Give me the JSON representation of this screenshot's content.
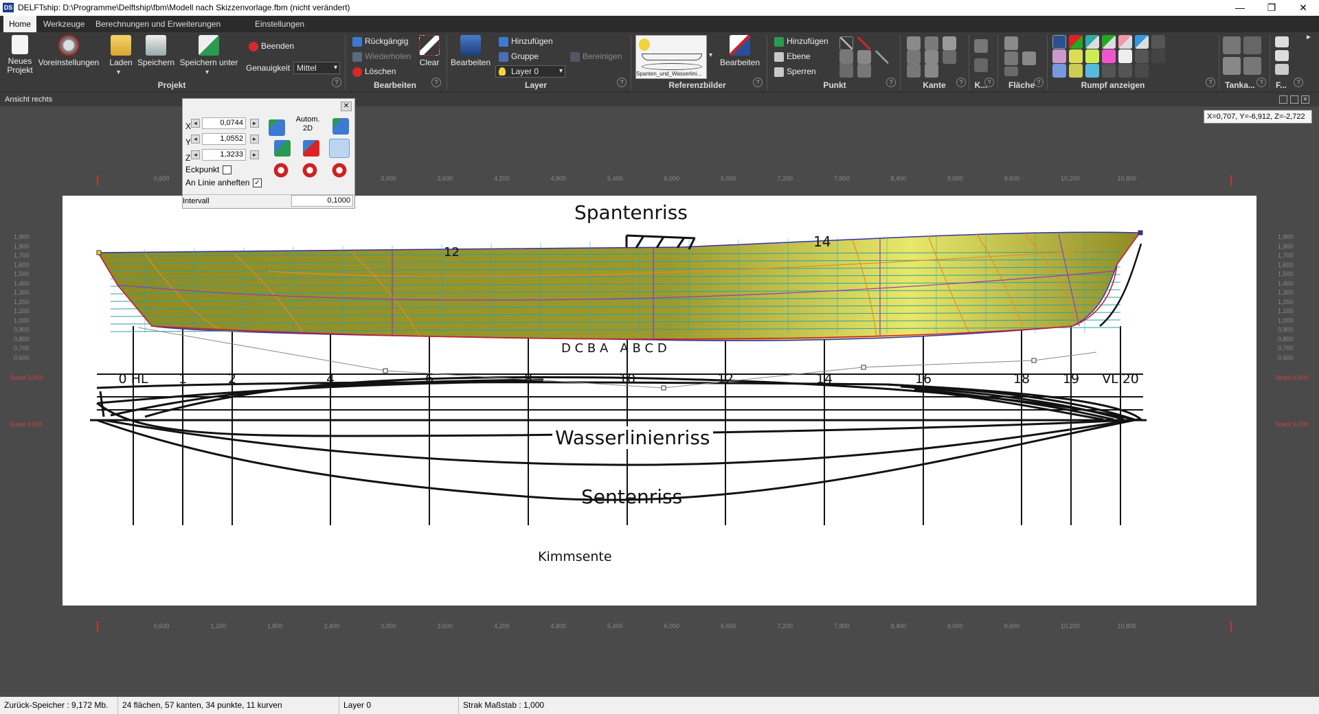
{
  "window": {
    "app_icon": "DS",
    "title": "DELFTship: D:\\Programme\\Delftship\\fbm\\Modell nach Skizzenvorlage.fbm (nicht verändert)",
    "minimize": "—",
    "maximize": "❐",
    "close": "✕"
  },
  "menu": {
    "tabs": [
      "Home",
      "Werkzeuge",
      "Berechnungen und Erweiterungen",
      "Einstellungen"
    ]
  },
  "ribbon": {
    "projekt": {
      "label": "Projekt",
      "neues_projekt_1": "Neues",
      "neues_projekt_2": "Projekt",
      "voreinstellungen": "Voreinstellungen",
      "laden": "Laden",
      "speichern": "Speichern",
      "speichern_unter": "Speichern unter",
      "beenden": "Beenden",
      "genauigkeit_label": "Genauigkeit",
      "genauigkeit_value": "Mittel"
    },
    "bearbeiten": {
      "label": "Bearbeiten",
      "rueckgaengig": "Rückgängig",
      "wiederholen": "Wiederholen",
      "loeschen": "Löschen",
      "clear": "Clear"
    },
    "layer": {
      "label": "Layer",
      "bearbeiten": "Bearbeiten",
      "hinzufuegen": "Hinzufügen",
      "gruppe": "Gruppe",
      "layer_value": "Layer 0",
      "bereinigen": "Bereinigen"
    },
    "referenzbilder": {
      "label": "Referenzbilder",
      "image_name": "Spanten_und_Wasserlini...",
      "bearbeiten": "Bearbeiten"
    },
    "punkt": {
      "label": "Punkt",
      "hinzufuegen": "Hinzufügen",
      "ebene": "Ebene",
      "sperren": "Sperren"
    },
    "kante": {
      "label": "Kante"
    },
    "k": {
      "label": "K..."
    },
    "flaeche": {
      "label": "Fläche"
    },
    "rumpf": {
      "label": "Rumpf anzeigen"
    },
    "tanka": {
      "label": "Tanka..."
    },
    "f": {
      "label": "F..."
    },
    "help_glyph": "?",
    "dropdown_glyph": "▾"
  },
  "view": {
    "title": "Ansicht rechts",
    "coord_readout": "X=0,707, Y=-6,912, Z=-2,722"
  },
  "point_panel": {
    "x_label": "X",
    "y_label": "Y",
    "z_label": "Z",
    "x_value": "0,0744",
    "y_value": "1,0552",
    "z_value": "1,3233",
    "autom_2d_1": "Autom.",
    "autom_2d_2": "2D",
    "eckpunkt": "Eckpunkt",
    "eckpunkt_checked": false,
    "an_linie_anheften": "An Linie anheften",
    "an_linie_checked": true,
    "check_glyph": "✓",
    "intervall_label": "Intervall",
    "intervall_value": "0,1000",
    "close_glyph": "✕",
    "left_glyph": "◄",
    "right_glyph": "►"
  },
  "drawing": {
    "spantenriss": "Spantenriss",
    "wasserlinienriss": "Wasserlinienriss",
    "sentenriss": "Sentenriss",
    "kimmsente": "Kimmsente",
    "station_labels": [
      "0 HL",
      "1",
      "2",
      "4",
      "6",
      "8",
      "10",
      "12",
      "14",
      "16",
      "18",
      "19",
      "VL 20"
    ],
    "upper_numbers": [
      "12",
      "14"
    ],
    "section_letters": "D C B A   A B C D"
  },
  "ruler": {
    "x_ticks": [
      "0,600",
      "1,200",
      "1,800",
      "2,400",
      "3,000",
      "3,600",
      "4,200",
      "4,800",
      "5,400",
      "6,000",
      "6,600",
      "7,200",
      "7,800",
      "8,400",
      "9,000",
      "9,600",
      "10,200",
      "10,800"
    ],
    "z_ticks": [
      "1,900",
      "1,800",
      "1,700",
      "1,600",
      "1,500",
      "1,400",
      "1,300",
      "1,200",
      "1,100",
      "1,000",
      "0,900",
      "0,800",
      "0,700",
      "0,600"
    ],
    "left_marker": "Spant 0,000",
    "right_marker": "Spant 0,000"
  },
  "status": {
    "zurueck_speicher": "Zurück-Speicher : 9,172 Mb.",
    "counts": "24 flächen, 57 kanten, 34 punkte, 11 kurven",
    "layer": "Layer 0",
    "strak": "Strak Maßstab : 1,000"
  },
  "colors": {
    "hull_fill": "#9c9a2e",
    "hull_highlight": "#e8e86a",
    "edge_red": "#d01c2c",
    "edge_blue": "#3030b0",
    "curve_orange": "#e09020",
    "waterline_teal": "#2aa0a0",
    "ribbon_bg": "#3a3a3a",
    "viewport_bg": "#4a4a4a"
  }
}
